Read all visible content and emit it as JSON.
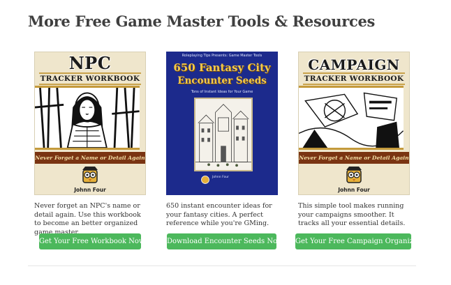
{
  "heading": "More Free Game Master Tools & Resources",
  "cards": [
    {
      "cover": {
        "title": "NPC",
        "subtitle": "TRACKER WORKBOOK",
        "tagline": "Never Forget a Name or Detail Again",
        "author": "Johnn Four"
      },
      "description": "Never forget an NPC's name or detail again. Use this workbook to become an better organized game master.",
      "button": "Get Your Free Workbook Now"
    },
    {
      "cover": {
        "topline": "Roleplaying Tips Presents: Game Master Tools",
        "title_line1": "650 Fantasy City",
        "title_line2": "Encounter Seeds",
        "subtitle": "Tons of Instant Ideas for Your Game",
        "publisher": "Johnn Four"
      },
      "description": "650 instant encounter ideas for your fantasy cities. A perfect reference while you're GMing.",
      "button": "Download Encounter Seeds Now"
    },
    {
      "cover": {
        "title": "CAMPAIGN",
        "subtitle": "TRACKER WORKBOOK",
        "tagline": "Never Forget a Name or Detail Again",
        "author": "Johnn Four"
      },
      "description": "This simple tool makes running your campaigns smoother. It tracks all your essential details.",
      "button": "Get Your Free Campaign Organizer"
    }
  ],
  "colors": {
    "button": "#4cb85c",
    "heading": "#3f3f3f",
    "band": "#7a3412",
    "city_bg": "#1c2a8c"
  }
}
